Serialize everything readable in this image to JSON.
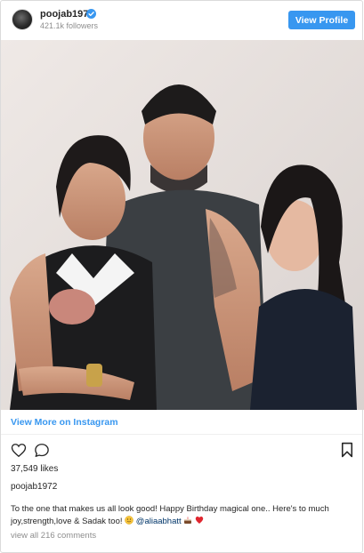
{
  "header": {
    "username": "poojab1972",
    "followers": "421.1k followers",
    "view_profile_label": "View Profile"
  },
  "photo": {
    "alt": "Photo of three people posing together"
  },
  "view_more_label": "View More on Instagram",
  "actions": {
    "icons": [
      "heart-icon",
      "comment-icon",
      "bookmark-icon"
    ]
  },
  "likes": "37,549 likes",
  "post_username": "poojab1972",
  "caption": {
    "text_line": "To the one that makes us all look good! Happy Birthday magical one.. Here's to much joy,strength,love & Sadak too!",
    "mention": "@aliaabhatt",
    "emojis": [
      "slightly-smiling-face",
      "cake",
      "red-heart"
    ]
  },
  "view_comments_label": "view all 216 comments",
  "colors": {
    "accent": "#3897f0",
    "text": "#262626",
    "muted": "#8e8e8e",
    "border": "#dbdbdb"
  }
}
